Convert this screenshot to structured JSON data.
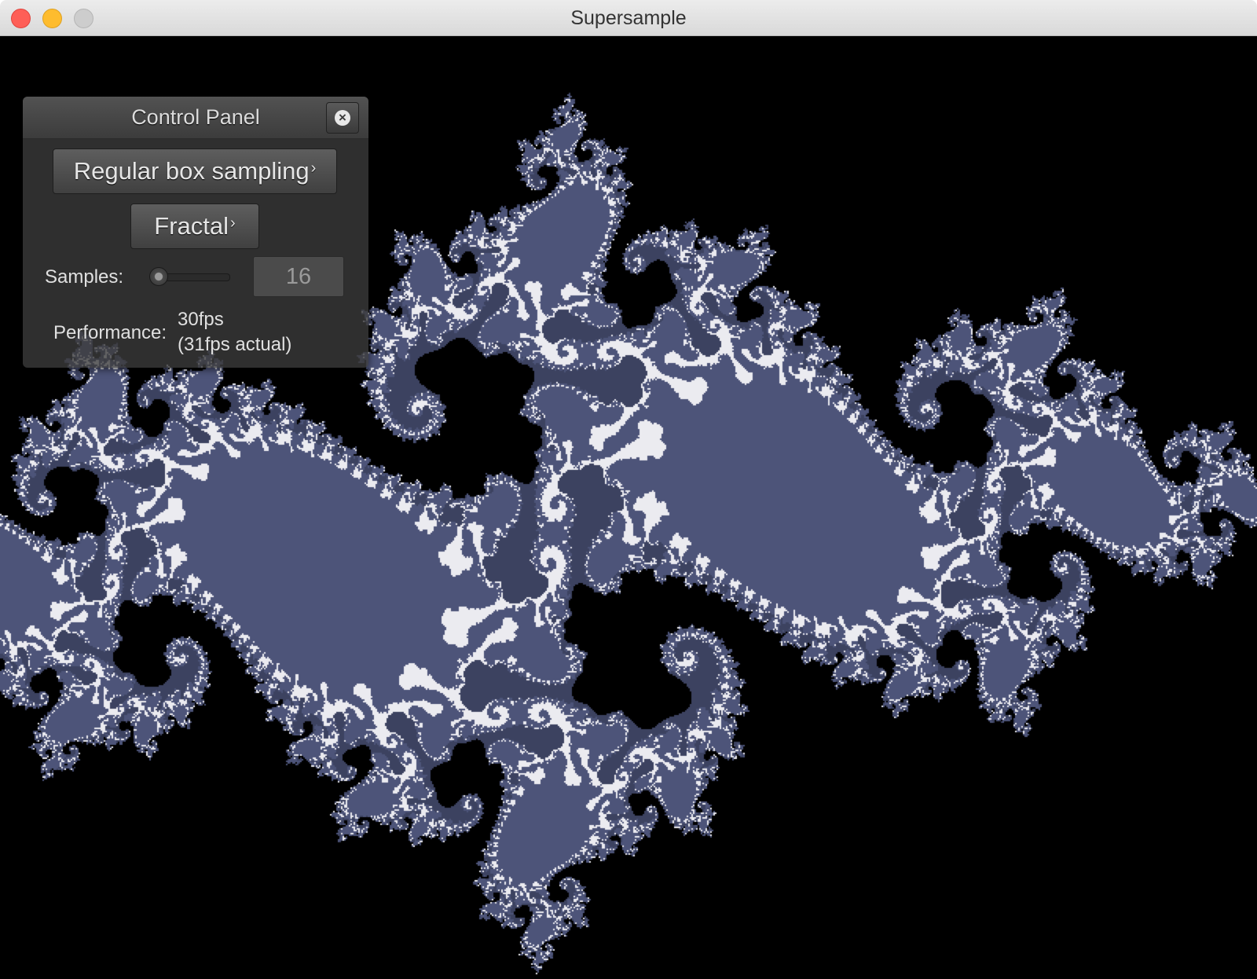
{
  "window": {
    "title": "Supersample",
    "colors": {
      "close": "#fe5f57",
      "minimize": "#febc2e",
      "zoom": "#cdcdcd"
    }
  },
  "canvas": {
    "content": "julia-set-fractal",
    "colors": {
      "background": "#000000",
      "fill": "#4d5479",
      "highlight": "#ffffff"
    }
  },
  "control_panel": {
    "title": "Control Panel",
    "close_icon": "close-circle-icon",
    "sampling_button": {
      "label": "Regular box sampling",
      "chevron": "›"
    },
    "fractal_button": {
      "label": "Fractal",
      "chevron": "›"
    },
    "samples": {
      "label": "Samples:",
      "value": "16",
      "slider_fraction": 0.0
    },
    "performance": {
      "label": "Performance:",
      "target": "30fps",
      "actual": "(31fps actual)"
    }
  }
}
